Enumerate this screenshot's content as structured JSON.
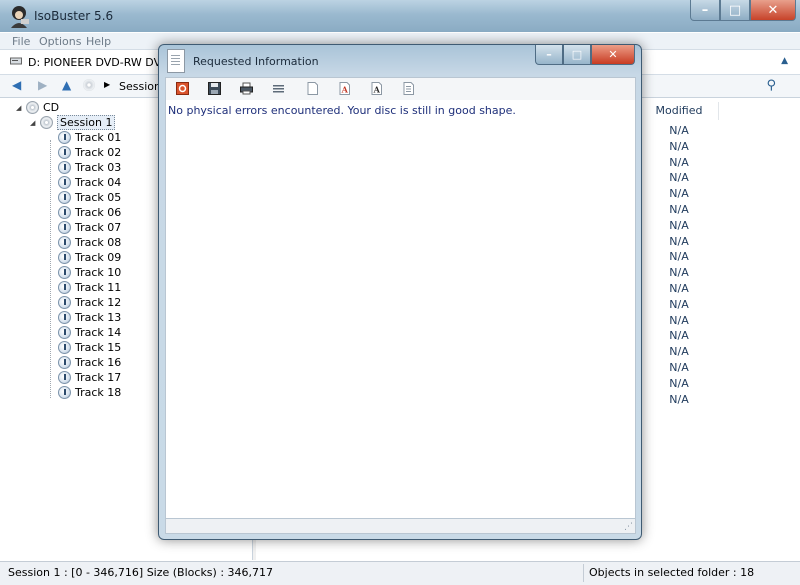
{
  "app": {
    "title": "IsoBuster 5.6"
  },
  "menu": [
    "File",
    "Options",
    "Help"
  ],
  "drive": {
    "label": "D: PIONEER  DVD-RW  DVR-11"
  },
  "path": {
    "label": "Session 1"
  },
  "tree": {
    "root": "CD",
    "session": "Session 1",
    "tracks": [
      "Track 01",
      "Track 02",
      "Track 03",
      "Track 04",
      "Track 05",
      "Track 06",
      "Track 07",
      "Track 08",
      "Track 09",
      "Track 10",
      "Track 11",
      "Track 12",
      "Track 13",
      "Track 14",
      "Track 15",
      "Track 16",
      "Track 17",
      "Track 18"
    ]
  },
  "list": {
    "column_modified": "Modified",
    "values": [
      "N/A",
      "N/A",
      "N/A",
      "N/A",
      "N/A",
      "N/A",
      "N/A",
      "N/A",
      "N/A",
      "N/A",
      "N/A",
      "N/A",
      "N/A",
      "N/A",
      "N/A",
      "N/A",
      "N/A",
      "N/A"
    ]
  },
  "status": {
    "left": "Session 1 : [0 - 346,716]  Size (Blocks) : 346,717",
    "right": "Objects in selected folder : 18"
  },
  "dialog": {
    "title": "Requested Information",
    "message": "No physical errors encountered.  Your disc is still in good shape.",
    "toolbar_icons": [
      "office-icon",
      "save-icon",
      "print-icon",
      "list-icon",
      "page-icon",
      "font-red-icon",
      "font-icon",
      "document-icon"
    ]
  },
  "colors": {
    "accent": "#2f6fb3",
    "close": "#c83b22",
    "text_blue": "#1e2f7a"
  }
}
